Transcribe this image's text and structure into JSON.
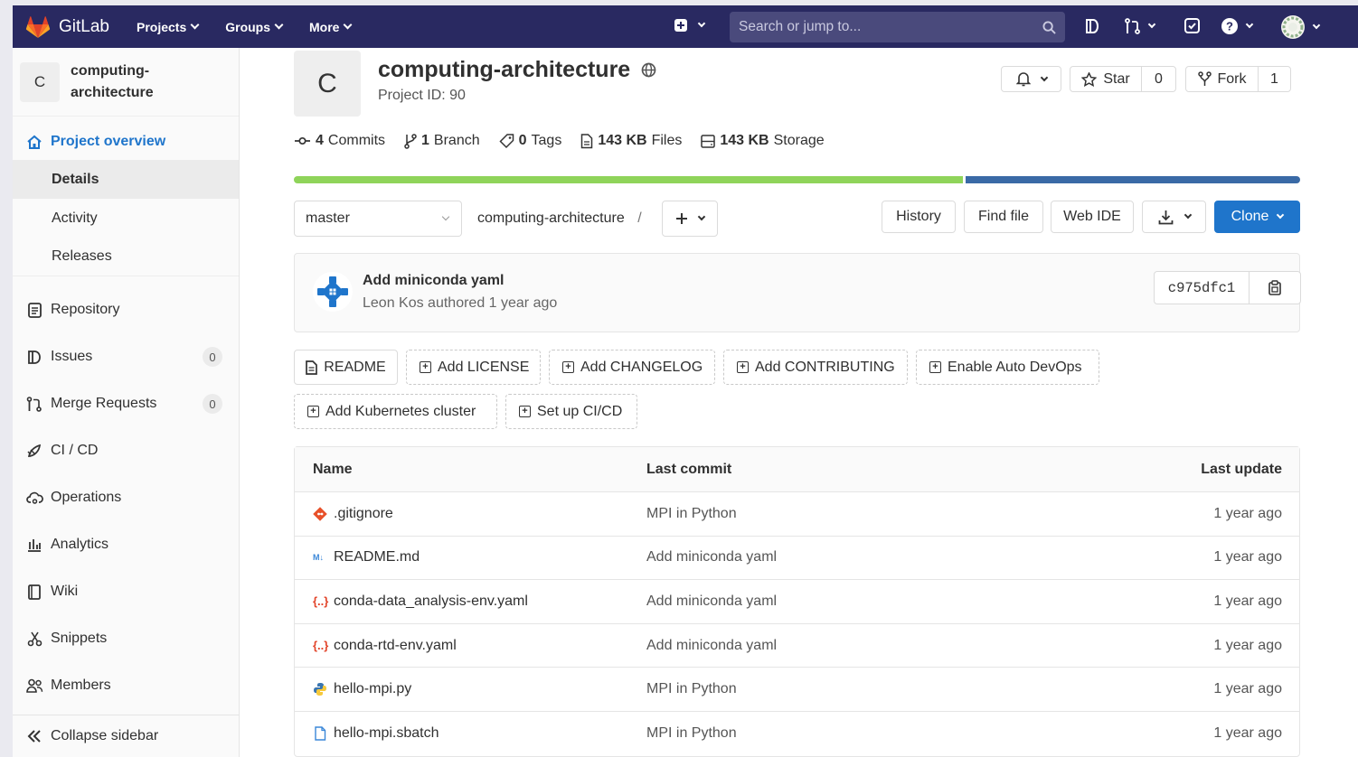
{
  "nav": {
    "brand": "GitLab",
    "menus": [
      "Projects",
      "Groups",
      "More"
    ],
    "search_placeholder": "Search or jump to..."
  },
  "sidebar": {
    "project_avatar": "C",
    "project_name_line1": "computing-",
    "project_name_line2": "architecture",
    "overview": "Project overview",
    "sub_items": [
      "Details",
      "Activity",
      "Releases"
    ],
    "items": [
      {
        "label": "Repository",
        "icon": "repository-icon"
      },
      {
        "label": "Issues",
        "icon": "issues-icon",
        "count": "0"
      },
      {
        "label": "Merge Requests",
        "icon": "merge-request-icon",
        "count": "0"
      },
      {
        "label": "CI / CD",
        "icon": "rocket-icon"
      },
      {
        "label": "Operations",
        "icon": "cloud-gear-icon"
      },
      {
        "label": "Analytics",
        "icon": "chart-icon"
      },
      {
        "label": "Wiki",
        "icon": "book-icon"
      },
      {
        "label": "Snippets",
        "icon": "scissors-icon"
      },
      {
        "label": "Members",
        "icon": "users-icon"
      }
    ],
    "collapse": "Collapse sidebar"
  },
  "project": {
    "avatar": "C",
    "title": "computing-architecture",
    "id_text": "Project ID: 90",
    "star_label": "Star",
    "star_count": "0",
    "fork_label": "Fork",
    "fork_count": "1",
    "stats": {
      "commits_count": "4",
      "commits_label": "Commits",
      "branch_count": "1",
      "branch_label": "Branch",
      "tags_count": "0",
      "tags_label": "Tags",
      "files_size": "143 KB",
      "files_label": "Files",
      "storage_size": "143 KB",
      "storage_label": "Storage"
    },
    "language_fraction": 0.665,
    "colors": {
      "lang1": "#8fd45a",
      "lang2": "#3a6aa6",
      "accent": "#1f75cb",
      "nav": "#292961"
    }
  },
  "toolbar": {
    "branch": "master",
    "path": "computing-architecture",
    "separator": "/",
    "history": "History",
    "find_file": "Find file",
    "web_ide": "Web IDE",
    "clone": "Clone"
  },
  "last_commit": {
    "message": "Add miniconda yaml",
    "meta": "Leon Kos authored 1 year ago",
    "sha": "c975dfc1"
  },
  "shortcuts": [
    "README",
    "Add LICENSE",
    "Add CHANGELOG",
    "Add CONTRIBUTING",
    "Enable Auto DevOps",
    "Add Kubernetes cluster",
    "Set up CI/CD"
  ],
  "files": {
    "headers": [
      "Name",
      "Last commit",
      "Last update"
    ],
    "rows": [
      {
        "name": ".gitignore",
        "icon": "git-icon",
        "commit": "MPI in Python",
        "updated": "1 year ago"
      },
      {
        "name": "README.md",
        "icon": "markdown-icon",
        "commit": "Add miniconda yaml",
        "updated": "1 year ago"
      },
      {
        "name": "conda-data_analysis-env.yaml",
        "icon": "yaml-icon",
        "commit": "Add miniconda yaml",
        "updated": "1 year ago"
      },
      {
        "name": "conda-rtd-env.yaml",
        "icon": "yaml-icon",
        "commit": "Add miniconda yaml",
        "updated": "1 year ago"
      },
      {
        "name": "hello-mpi.py",
        "icon": "python-icon",
        "commit": "MPI in Python",
        "updated": "1 year ago"
      },
      {
        "name": "hello-mpi.sbatch",
        "icon": "file-icon",
        "commit": "MPI in Python",
        "updated": "1 year ago"
      }
    ]
  }
}
